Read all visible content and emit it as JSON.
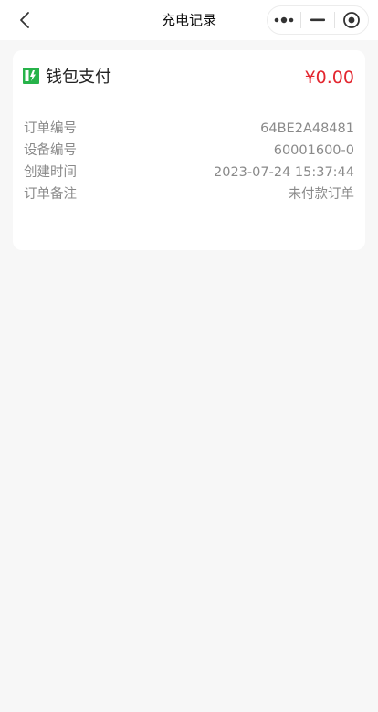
{
  "navbar": {
    "title": "充电记录",
    "back_icon": "chevron-left-icon",
    "capsule_icons": [
      "more-dots-icon",
      "minimize-icon",
      "close-target-icon"
    ]
  },
  "order": {
    "pay_icon": "battery-charge-icon",
    "pay_method": "钱包支付",
    "amount": "¥0.00",
    "fields": [
      {
        "label": "订单编号",
        "value": "64BE2A48481"
      },
      {
        "label": "设备编号",
        "value": "60001600-0"
      },
      {
        "label": "创建时间",
        "value": "2023-07-24 15:37:44"
      },
      {
        "label": "订单备注",
        "value": "未付款订单"
      }
    ]
  },
  "colors": {
    "accent_green": "#27b34a",
    "amount_red": "#e3262f",
    "label_gray": "#8a8a8a",
    "page_bg": "#f7f7f7"
  }
}
